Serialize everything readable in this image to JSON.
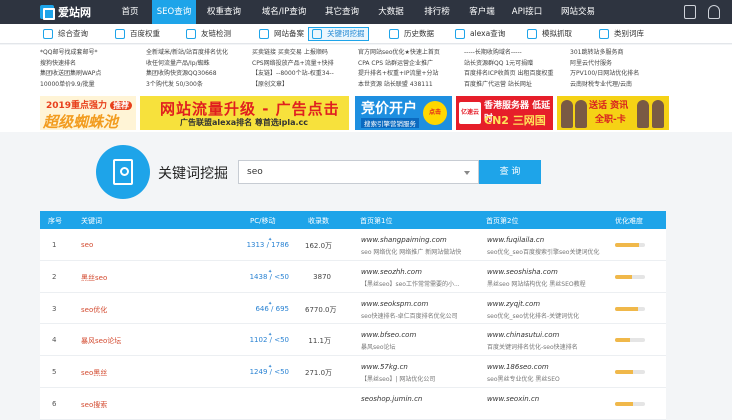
{
  "nav": {
    "logo": "爱站网",
    "items": [
      {
        "label": "首页"
      },
      {
        "label": "SEO查询"
      },
      {
        "label": "权重查询"
      },
      {
        "label": "域名/IP查询"
      },
      {
        "label": "其它查询"
      },
      {
        "label": "大数据"
      },
      {
        "label": "排行榜"
      },
      {
        "label": "客户端"
      },
      {
        "label": "API接口"
      },
      {
        "label": "网站交易"
      }
    ]
  },
  "tools": [
    {
      "label": "综合查询"
    },
    {
      "label": "百度权重"
    },
    {
      "label": "友链检测"
    },
    {
      "label": "网站备案"
    },
    {
      "label": "关键词挖掘"
    },
    {
      "label": "历史数据"
    },
    {
      "label": "alexa查询"
    },
    {
      "label": "模拟抓取"
    },
    {
      "label": "类别词库"
    }
  ],
  "ad_text": [
    [
      "*QQ邮号找成套邮号*",
      "搜狗快速排名",
      "集团收送团集刷WAP点",
      "10000单价9.9/批量"
    ],
    [
      "全新域米/新站/站百度排名优化",
      "收任何流量产品/Ip/蜘蛛",
      "集团收购快资源QQ30668",
      "3个购代发 50/300条"
    ],
    [
      "买卖链接 买卖交易 上报顺码",
      "CPS网络投放产品+流量+快排",
      "【友链】--8000个站-权重34--",
      "【原创文章】"
    ],
    [
      "官方网站seo优化★快速上首页",
      "CPA CPS 站群运营企业推广",
      "提升排名+权重+IP流量+分站",
      "本世资源 站长联盟 438111"
    ],
    [
      "-----长期收购域名-----",
      "站长资源群QQ 1元可捐赠",
      "百度排名ICP收首页 出租百度权重",
      "百度推广代运营 站长网址"
    ],
    [
      "301跳转站多服务商",
      "阿里云代付服务",
      "万PV100/日网站优化排名",
      "云南财税专业代理/云南"
    ]
  ],
  "banners": {
    "b1_title": "2019重点强力",
    "b1_tag": "推荐",
    "b1_main": "超级蜘蛛池",
    "b2_main": "网站流量升级 - 广告点击",
    "b2_sub": "广告联盟alexa排名 尊首选ipla.cc",
    "b3_main": "竞价开户",
    "b3_sub": "搜索引擎营销服务",
    "b3_tag": "点击",
    "b4_logo": "亿速云",
    "b4_t1": "香港服务器 低延时",
    "b4_t2": "CN2 三网国际带宽",
    "b5_t1": "送话 资讯",
    "b5_t2": "全职-卡"
  },
  "search": {
    "title": "关键词挖掘",
    "value": "seo",
    "button": "查 询"
  },
  "table": {
    "headers": [
      "序号",
      "关键词",
      "PC/移动",
      "收录数",
      "首页第1位",
      "首页第2位",
      "优化难度"
    ],
    "rows": [
      {
        "no": "1",
        "kw": "seo",
        "pc": "1313 / 1786",
        "vol": "162.0万",
        "u1": "www.shangpaiming.com",
        "d1": "seo 网络优化 网络推广 新网站做站快",
        "u2": "www.fuqilaila.cn",
        "d2": "seo优化_seo百度搜索引擎seo关键词优化",
        "diff": 0.8
      },
      {
        "no": "2",
        "kw": "黑丝seo",
        "pc": "1438 / <50",
        "vol": "3870",
        "u1": "www.seozhh.com",
        "d1": "【黑丝seo】seo工作常常需要的小...",
        "u2": "www.seoshisha.com",
        "d2": "黑丝seo 网站结构优化 黑丝SEO教程",
        "diff": 0.55
      },
      {
        "no": "3",
        "kw": "seo优化",
        "pc": "646 / 695",
        "vol": "6770.0万",
        "u1": "www.seokspm.com",
        "d1": "seo快速排名-卓仁百度排名优化公司",
        "u2": "www.zyqjt.com",
        "d2": "seo优化_seo优化排名-关键词优化",
        "diff": 0.75
      },
      {
        "no": "4",
        "kw": "暴风seo论坛",
        "pc": "1102 / <50",
        "vol": "11.1万",
        "u1": "www.bfseo.com",
        "d1": "暴风seo论坛",
        "u2": "www.chinasutui.com",
        "d2": "百度关键词排名优化-seo快速排名",
        "diff": 0.5
      },
      {
        "no": "5",
        "kw": "seo黑丝",
        "pc": "1249 / <50",
        "vol": "271.0万",
        "u1": "www.57kg.cn",
        "d1": "【黑丝seo】| 网站优化公司",
        "u2": "www.186seo.com",
        "d2": "seo黑丝专业优化 黑丝SEO",
        "diff": 0.6
      },
      {
        "no": "6",
        "kw": "seo搜索",
        "pc": "",
        "vol": "",
        "u1": "seoshop.jumin.cn",
        "d1": "",
        "u2": "www.seoxin.cn",
        "d2": "",
        "diff": 0.6
      }
    ]
  }
}
